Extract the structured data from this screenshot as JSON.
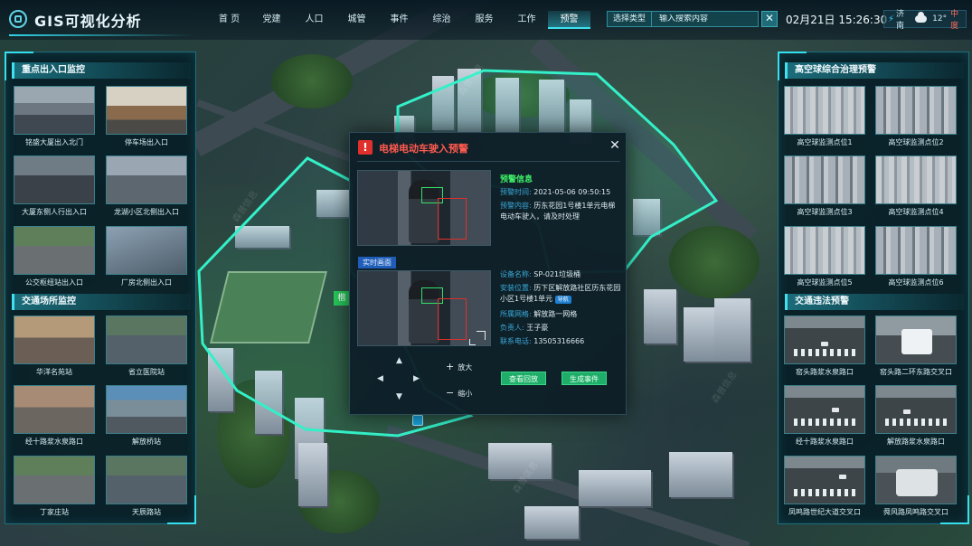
{
  "app": {
    "title": "GIS可视化分析"
  },
  "nav": [
    {
      "label": "首 页",
      "active": false
    },
    {
      "label": "党建",
      "active": false
    },
    {
      "label": "人口",
      "active": false
    },
    {
      "label": "城管",
      "active": false
    },
    {
      "label": "事件",
      "active": false
    },
    {
      "label": "综治",
      "active": false
    },
    {
      "label": "服务",
      "active": false
    },
    {
      "label": "工作",
      "active": false
    },
    {
      "label": "预警",
      "active": true
    }
  ],
  "search": {
    "type_label": "选择类型",
    "placeholder": "输入搜索内容",
    "clear_icon": "close-icon"
  },
  "datetime": "02月21日 15:26:30",
  "weather": {
    "city": "济南",
    "icon": "cloud-icon",
    "temp": "12°",
    "aqi": "中度"
  },
  "left_panel": {
    "section1": {
      "title": "重点出入口监控",
      "cameras": [
        {
          "label": "铭盛大厦出入北门",
          "scene": "sc-gate"
        },
        {
          "label": "停车场出入口",
          "scene": "sc-booth"
        },
        {
          "label": "大厦东侧人行出入口",
          "scene": "sc-turnstile"
        },
        {
          "label": "龙湖小区北侧出入口",
          "scene": "sc-street"
        },
        {
          "label": "公交枢纽站出入口",
          "scene": "sc-bus"
        },
        {
          "label": "厂房北侧出入口",
          "scene": "sc-rain"
        }
      ]
    },
    "section2": {
      "title": "交通场所监控",
      "cameras": [
        {
          "label": "华洋名苑站",
          "scene": "sc-market"
        },
        {
          "label": "省立医院站",
          "scene": "sc-station"
        },
        {
          "label": "经十路浆水泉路口",
          "scene": "sc-crowd"
        },
        {
          "label": "解放桥站",
          "scene": "sc-shelter"
        },
        {
          "label": "丁家庄站",
          "scene": "sc-bus"
        },
        {
          "label": "天辰路站",
          "scene": "sc-station"
        }
      ]
    }
  },
  "right_panel": {
    "section1": {
      "title": "高空球综合治理预警",
      "cameras": [
        {
          "label": "高空球监测点位1",
          "scene": "sc-city"
        },
        {
          "label": "高空球监测点位2",
          "scene": "sc-city2"
        },
        {
          "label": "高空球监测点位3",
          "scene": "sc-city2"
        },
        {
          "label": "高空球监测点位4",
          "scene": "sc-city"
        },
        {
          "label": "高空球监测点位5",
          "scene": "sc-city"
        },
        {
          "label": "高空球监测点位6",
          "scene": "sc-city2"
        }
      ]
    },
    "section2": {
      "title": "交通违法预警",
      "cameras": [
        {
          "label": "窑头路浆水泉路口",
          "scene": "sc-road"
        },
        {
          "label": "窑头路二环东路交叉口",
          "scene": "sc-van"
        },
        {
          "label": "经十路浆水泉路口",
          "scene": "sc-road"
        },
        {
          "label": "解放路浆水泉路口",
          "scene": "sc-road"
        },
        {
          "label": "凤鸣路世纪大道交叉口",
          "scene": "sc-road"
        },
        {
          "label": "舜风路凤鸣路交叉口",
          "scene": "sc-suv"
        }
      ]
    }
  },
  "dialog": {
    "title": "电梯电动车驶入预警",
    "warn_icon": "warning-icon",
    "live_tag": "实时画面",
    "info_head": "预警信息",
    "alert_time_key": "预警时间:",
    "alert_time": "2021-05-06  09:50:15",
    "alert_content_key": "预警内容:",
    "alert_content": "历东花园1号楼1单元电梯电动车驶入，请及时处理",
    "device_name_key": "设备名称:",
    "device_name": "SP-021垃圾桶",
    "location_key": "安装位置:",
    "location": "历下区解放路社区历东花园小区1号楼1单元",
    "location_tag": "导航",
    "grid_key": "所属网格:",
    "grid": "解放路一网格",
    "owner_key": "负责人:",
    "owner": "王子豪",
    "phone_key": "联系电话:",
    "phone": "13505316666",
    "zoom_in": "放大",
    "zoom_out": "缩小",
    "btn_playback": "查看回放",
    "btn_event": "生成事件"
  },
  "map": {
    "label_tag": "楷"
  },
  "watermark": "森普信息"
}
